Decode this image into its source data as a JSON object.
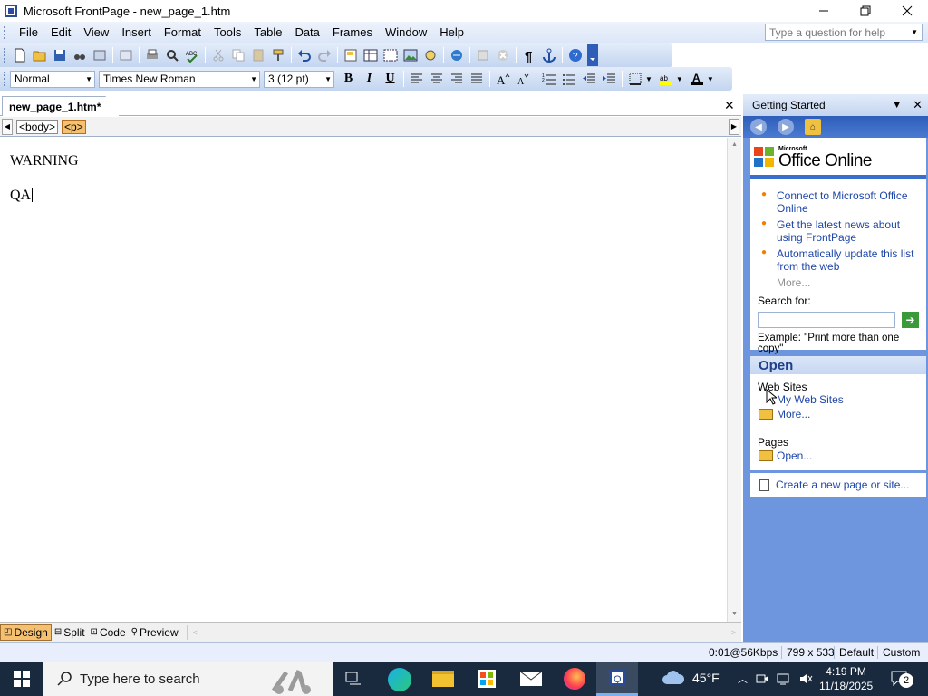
{
  "window": {
    "title": "Microsoft FrontPage - new_page_1.htm"
  },
  "menu": {
    "items": [
      "File",
      "Edit",
      "View",
      "Insert",
      "Format",
      "Tools",
      "Table",
      "Data",
      "Frames",
      "Window",
      "Help"
    ]
  },
  "help": {
    "placeholder": "Type a question for help"
  },
  "formatting": {
    "style": "Normal",
    "font": "Times New Roman",
    "size": "3 (12 pt)"
  },
  "document": {
    "tab_label": "new_page_1.htm*",
    "tags": [
      "<body>",
      "<p>"
    ],
    "lines": [
      "WARNING",
      "QA"
    ]
  },
  "views": {
    "design": "Design",
    "split": "Split",
    "code": "Code",
    "preview": "Preview"
  },
  "taskpane": {
    "title": "Getting Started",
    "brand_small": "Microsoft",
    "brand": "Office Online",
    "links": [
      "Connect to Microsoft Office Online",
      "Get the latest news about using FrontPage",
      "Automatically update this list from the web"
    ],
    "more": "More...",
    "search_label": "Search for:",
    "search_example": "Example:  \"Print more than one copy\"",
    "open_title": "Open",
    "web_sites_label": "Web Sites",
    "my_web_sites": "My Web Sites",
    "web_more": "More...",
    "pages_label": "Pages",
    "pages_open": "Open...",
    "create_link": "Create a new page or site..."
  },
  "status": {
    "speed": "0:01@56Kbps",
    "dimensions": "799 x 533",
    "mode": "Default",
    "custom": "Custom"
  },
  "taskbar": {
    "search_placeholder": "Type here to search",
    "temperature": "45°F",
    "time": "4:19 PM",
    "date": "11/18/2025",
    "notifications": "2"
  },
  "colors": {
    "pane_blue": "#6d96de",
    "link_blue": "#1f47a8",
    "selected_orange": "#f5c070",
    "taskbar": "#1a2a3e"
  }
}
